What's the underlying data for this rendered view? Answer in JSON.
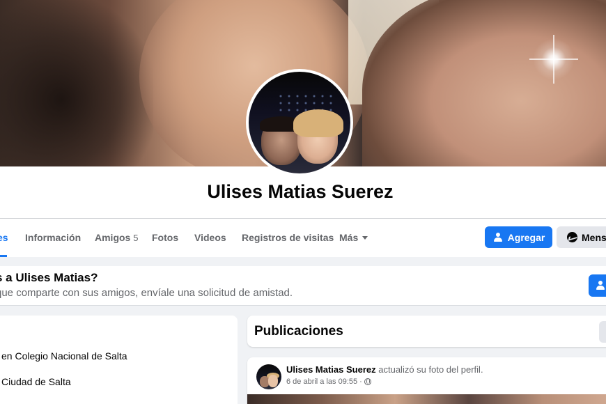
{
  "profile": {
    "name": "Ulises Matias Suerez"
  },
  "nav": {
    "tabs": [
      {
        "label": "es"
      },
      {
        "label": "Información"
      },
      {
        "label": "Amigos",
        "count": "5"
      },
      {
        "label": "Fotos"
      },
      {
        "label": "Videos"
      },
      {
        "label": "Registros de visitas"
      },
      {
        "label": "Más"
      }
    ],
    "add_button": "Agregar",
    "message_button": "Mensa"
  },
  "friend_request": {
    "title": "s a Ulises Matias?",
    "subtitle": "que comparte con sus amigos, envíale una solicitud de amistad."
  },
  "intro": {
    "items": [
      "en Colegio Nacional de Salta",
      "Ciudad de Salta"
    ]
  },
  "posts_section": {
    "title": "Publicaciones"
  },
  "post": {
    "author": "Ulises Matias Suerez",
    "action": "actualizó su foto del perfil.",
    "timestamp": "6 de abril a las 09:55",
    "separator": "·"
  },
  "colors": {
    "accent": "#1877f2",
    "background": "#f0f2f5",
    "secondary_text": "#65676b"
  },
  "icons": [
    "user-plus-icon",
    "messenger-icon",
    "caret-down-icon",
    "globe-icon"
  ]
}
